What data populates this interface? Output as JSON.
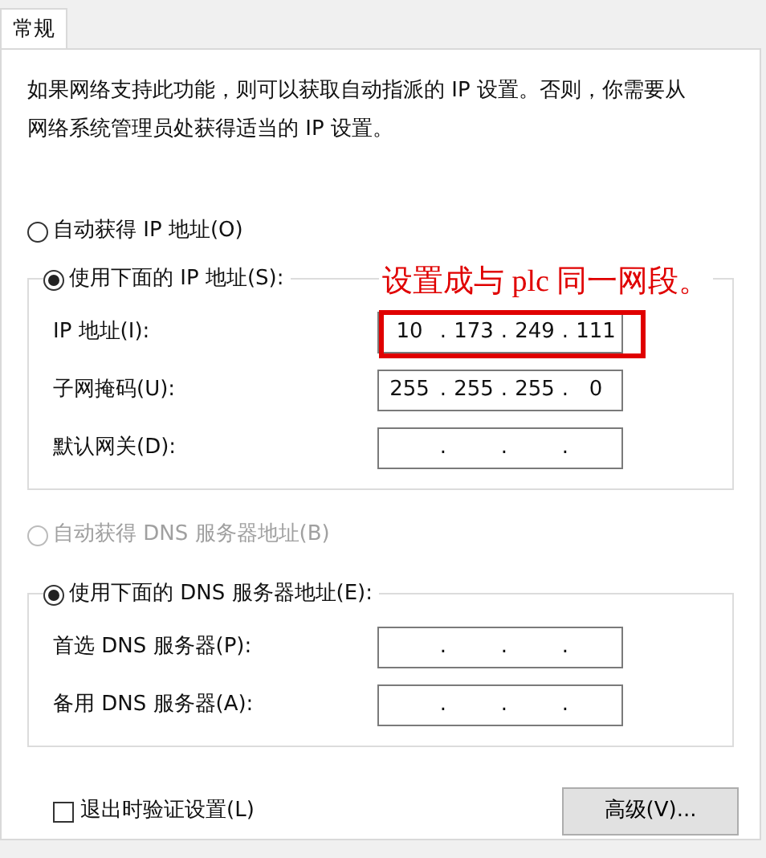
{
  "tabs": [
    {
      "label": "常规",
      "selected": true
    }
  ],
  "description": "如果网络支持此功能，则可以获取自动指派的 IP 设置。否则，你需要从网络系统管理员处获得适当的 IP 设置。",
  "ip_mode": {
    "options": [
      {
        "label": "自动获得 IP 地址(O)",
        "selected": false,
        "disabled": false
      },
      {
        "label": "使用下面的 IP 地址(S):",
        "selected": true,
        "disabled": false
      }
    ],
    "fields": [
      {
        "label": "IP 地址(I):",
        "octets": [
          "10",
          "173",
          "249",
          "111"
        ],
        "separators": [
          ".",
          ".",
          "."
        ],
        "highlighted": true
      },
      {
        "label": "子网掩码(U):",
        "octets": [
          "255",
          "255",
          "255",
          "0"
        ],
        "separators": [
          ".",
          ".",
          "."
        ],
        "highlighted": false
      },
      {
        "label": "默认网关(D):",
        "separators": [
          ".",
          ".",
          "."
        ],
        "highlighted": false
      }
    ]
  },
  "dns_mode": {
    "options": [
      {
        "label": "自动获得 DNS 服务器地址(B)",
        "selected": false,
        "disabled": true
      },
      {
        "label": "使用下面的 DNS 服务器地址(E):",
        "selected": true,
        "disabled": false
      }
    ],
    "fields": [
      {
        "label": "首选 DNS 服务器(P):",
        "separators": [
          ".",
          ".",
          "."
        ],
        "highlighted": false
      },
      {
        "label": "备用 DNS 服务器(A):",
        "separators": [
          ".",
          ".",
          "."
        ],
        "highlighted": false
      }
    ]
  },
  "validate_on_exit": {
    "label": "退出时验证设置(L)",
    "checked": false
  },
  "advanced_button": "高级(V)...",
  "annotation": "设置成与 plc 同一网段。"
}
